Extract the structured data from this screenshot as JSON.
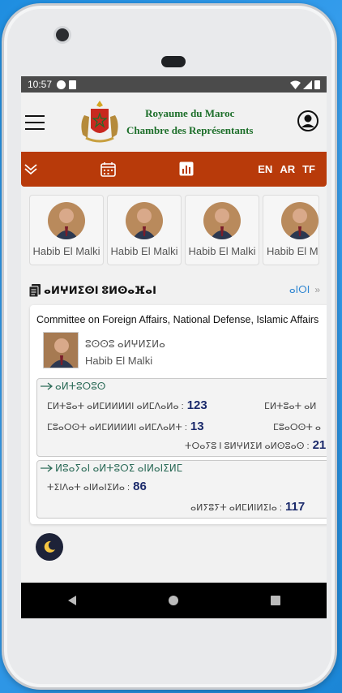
{
  "status_bar": {
    "time": "10:57"
  },
  "header": {
    "title_line1": "Royaume du Maroc",
    "title_line2": "Chambre des Représentants"
  },
  "nav": {
    "languages": [
      "EN",
      "AR",
      "TF"
    ]
  },
  "members": [
    {
      "name": "Habib El Malki"
    },
    {
      "name": "Habib El Malki"
    },
    {
      "name": "Habib El Malki"
    },
    {
      "name": "Habib El Malki"
    }
  ],
  "section": {
    "title": "ⴰⵍⵖⵍⵉⵙⵏ ⵓⵍⵙⴰⴼⴰⵏ",
    "more_label": "ⴰⵏⵔⵏ",
    "more_chevron": "»"
  },
  "committee": {
    "title": "Committee on Foreign Affairs, National Defense, Islamic Affairs",
    "president_role": "ⵓⵙⵙⵓ ⴰⵍⵖⵍⵉⵍⴰ",
    "president_name": "Habib El Malki",
    "box1": {
      "heading": "ⴰⵍⵜⵓⵔⵓⵙ",
      "stats": [
        {
          "label": "ⵎⵍⵜⵓⴰⵜ ⴰⵍⵎⵍⵍⵍⵍⵏ ⴰⵍⵎⴷⴰⵍⴰ :",
          "value": "123"
        },
        {
          "label": "ⵎⵍⵜⵓⴰⵜ ⴰⵍ",
          "value": ""
        },
        {
          "label": "ⵎⵓⴰⵔⵙⵜ ⴰⵍⵎⵍⵍⵍⵍⵏ ⴰⵍⵎⴷⴰⵍⵜ :",
          "value": "13"
        },
        {
          "label": "ⵎⵓⴰⵔⵙⵜ ⴰ",
          "value": ""
        },
        {
          "label": "ⵜⵔⴰⵢⵓ ⵏ ⵓⵍⵖⵍⵉⵍ ⴰⵍⵙⵓⴰⵙ :",
          "value": "21"
        }
      ]
    },
    "box2": {
      "heading": "ⵍⵓⴰⵢⴰⵏ ⴰⵍⵜⵓⵔⵉ ⴰⵏⵍⴰⵏⵉⵍⵎ",
      "stats": [
        {
          "label": "ⵜⵉⵏⴷⴰⵜ ⴰⵏⵍⴰⵏⵉⵍⴰ :",
          "value": "86"
        },
        {
          "label": "ⴰⵍⵢⵓⵢⵜ ⴰⵍⵎⵍⵏⵍⵉⵏⴰ :",
          "value": "117"
        }
      ]
    }
  }
}
